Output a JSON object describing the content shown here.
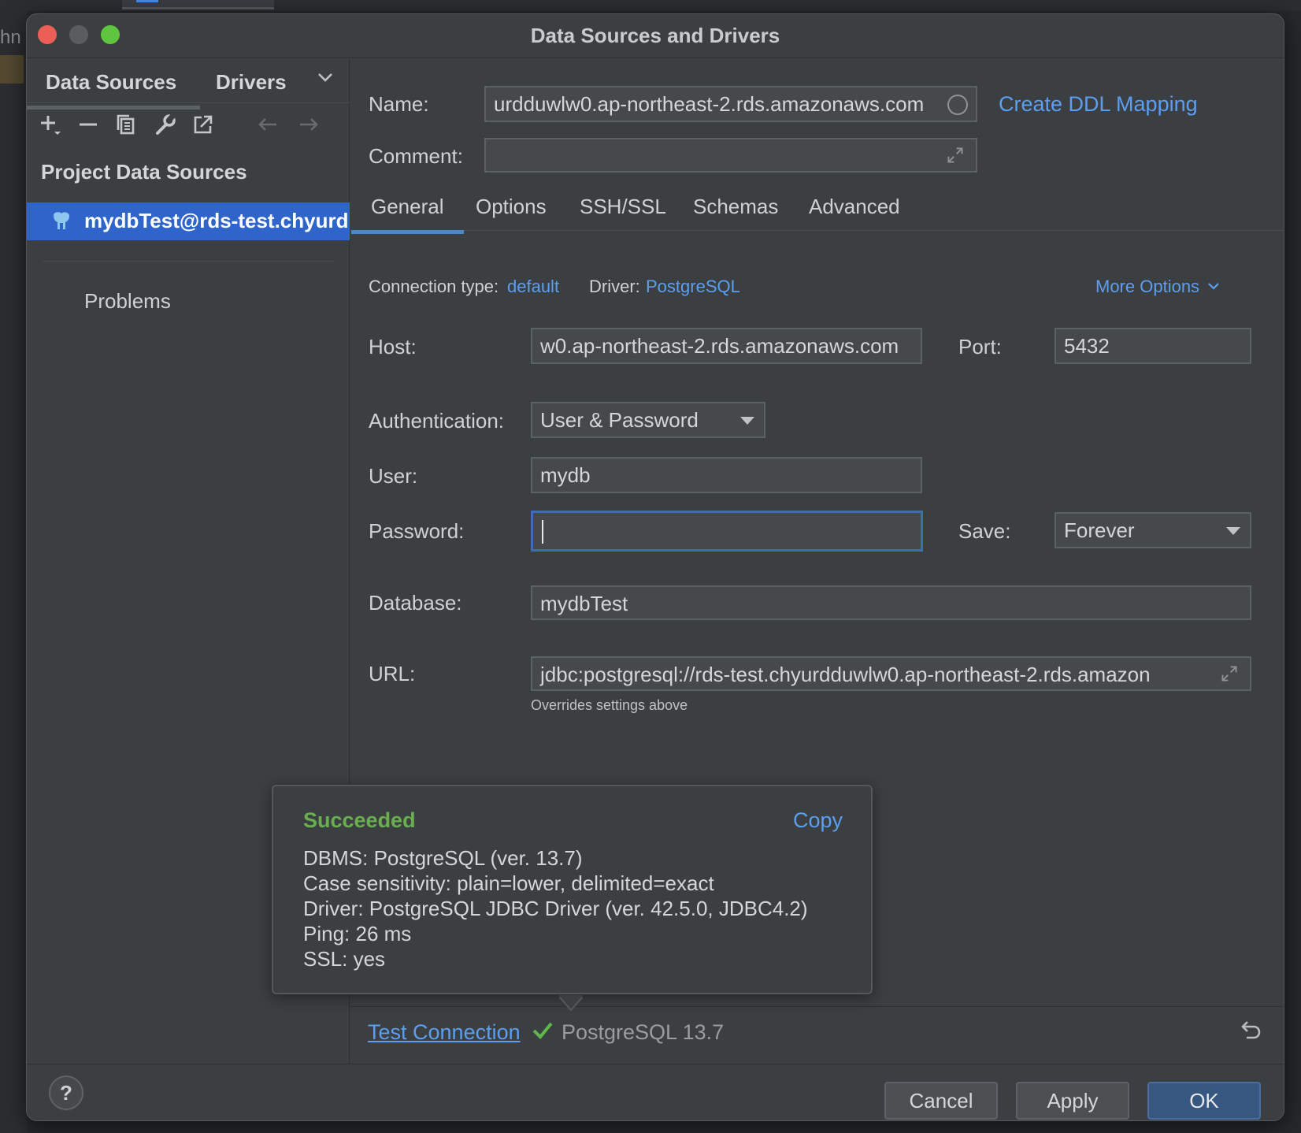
{
  "background": {
    "left_text": "hn"
  },
  "dialog": {
    "title": "Data Sources and Drivers"
  },
  "sidebar": {
    "tabs": [
      "Data Sources",
      "Drivers"
    ],
    "section_title": "Project Data Sources",
    "selected_item": "mydbTest@rds-test.chyurd",
    "problems_label": "Problems"
  },
  "form": {
    "name_label": "Name:",
    "name_value": "urdduwlw0.ap-northeast-2.rds.amazonaws.com",
    "create_ddl_link": "Create DDL Mapping",
    "comment_label": "Comment:",
    "comment_value": "",
    "tabs": [
      "General",
      "Options",
      "SSH/SSL",
      "Schemas",
      "Advanced"
    ],
    "connection_type_label": "Connection type:",
    "connection_type_value": "default",
    "driver_label": "Driver:",
    "driver_value": "PostgreSQL",
    "more_options": "More Options",
    "host_label": "Host:",
    "host_value": "w0.ap-northeast-2.rds.amazonaws.com",
    "port_label": "Port:",
    "port_value": "5432",
    "auth_label": "Authentication:",
    "auth_value": "User & Password",
    "user_label": "User:",
    "user_value": "mydb",
    "password_label": "Password:",
    "password_value": "",
    "save_label": "Save:",
    "save_value": "Forever",
    "database_label": "Database:",
    "database_value": "mydbTest",
    "url_label": "URL:",
    "url_value": "jdbc:postgresql://rds-test.chyurdduwlw0.ap-northeast-2.rds.amazon",
    "url_hint": "Overrides settings above"
  },
  "popup": {
    "status": "Succeeded",
    "copy_label": "Copy",
    "lines": [
      "DBMS: PostgreSQL (ver. 13.7)",
      "Case sensitivity: plain=lower, delimited=exact",
      "Driver: PostgreSQL JDBC Driver (ver. 42.5.0, JDBC4.2)",
      "Ping: 26 ms",
      "SSL: yes"
    ]
  },
  "test_bar": {
    "test_connection": "Test Connection",
    "result_version": "PostgreSQL 13.7"
  },
  "footer": {
    "help": "?",
    "cancel": "Cancel",
    "apply": "Apply",
    "ok": "OK"
  },
  "colors": {
    "accent": "#2f65ca",
    "link": "#5c9eef",
    "success": "#6aaf4f",
    "primary_button": "#365880"
  }
}
